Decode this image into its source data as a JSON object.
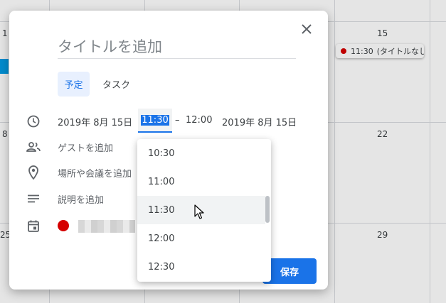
{
  "calendar": {
    "day_numbers": [
      "1",
      "15",
      "8",
      "22",
      "25",
      "29"
    ],
    "event_chip": {
      "time": "11:30",
      "title": "(タイトルなし)",
      "color": "#d50000"
    }
  },
  "dialog": {
    "title_placeholder": "タイトルを追加",
    "tabs": [
      {
        "label": "予定",
        "active": true
      },
      {
        "label": "タスク",
        "active": false
      }
    ],
    "datetime": {
      "start_date": "2019年 8月 15日",
      "start_time": "11:30",
      "separator": "–",
      "end_time": "12:00",
      "end_date": "2019年 8月 15日"
    },
    "guest_placeholder": "ゲストを追加",
    "location_placeholder": "場所や会議を追加",
    "description_placeholder": "説明を追加",
    "calendar_color": "#d50000",
    "save_label": "保存"
  },
  "time_dropdown": {
    "options": [
      "10:30",
      "11:00",
      "11:30",
      "12:00",
      "12:30"
    ],
    "highlighted": "11:30"
  },
  "icons": [
    "close-icon",
    "clock-icon",
    "people-icon",
    "location-pin-icon",
    "notes-icon",
    "calendar-icon",
    "mouse-cursor-icon"
  ],
  "colors": {
    "accent": "#1a73e8",
    "event_red": "#d50000",
    "tab_active_bg": "#e8f0fe"
  }
}
